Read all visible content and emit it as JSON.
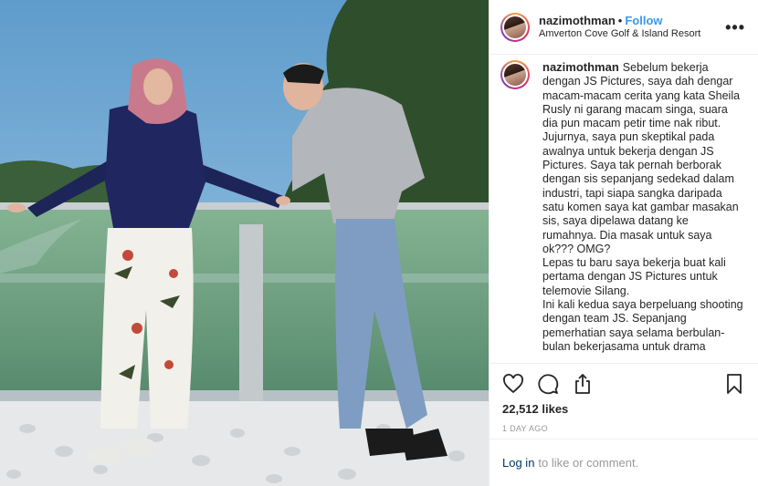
{
  "header": {
    "username": "nazimothman",
    "separator": "•",
    "follow_label": "Follow",
    "location": "Amverton Cove Golf & Island Resort",
    "more_label": "•••"
  },
  "caption": {
    "username": "nazimothman",
    "text": "Sebelum bekerja dengan JS Pictures, saya dah dengar macam-macam cerita yang kata Sheila Rusly ni garang macam singa, suara dia pun macam petir time nak ribut. Jujurnya, saya pun skeptikal pada awalnya untuk bekerja dengan JS Pictures. Saya tak pernah berborak dengan sis sepanjang sedekad dalam industri, tapi siapa sangka daripada satu komen saya kat gambar masakan sis, saya dipelawa datang ke rumahnya. Dia masak untuk saya ok??? OMG?\nLepas tu baru saya bekerja buat kali pertama dengan JS Pictures untuk telemovie Silang.\nIni kali kedua saya berpeluang shooting dengan team JS. Sepanjang pemerhatian saya selama berbulan-bulan bekerjasama untuk drama"
  },
  "icons": {
    "like": "heart-icon",
    "comment": "comment-icon",
    "share": "share-icon",
    "save": "bookmark-icon"
  },
  "likes": "22,512 likes",
  "timestamp": "1 DAY AGO",
  "login": {
    "link": "Log in",
    "text": "to like or comment."
  }
}
